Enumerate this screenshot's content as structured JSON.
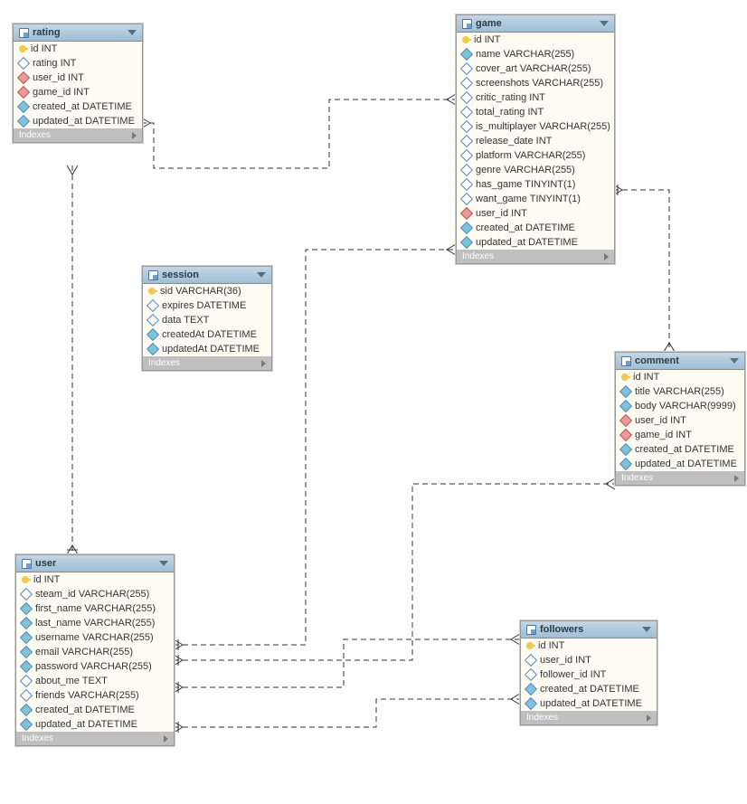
{
  "entities": {
    "rating": {
      "title": "rating",
      "indexes_label": "Indexes",
      "fields": [
        {
          "name": "id INT",
          "icon": "key"
        },
        {
          "name": "rating INT",
          "icon": "diam"
        },
        {
          "name": "user_id INT",
          "icon": "fk"
        },
        {
          "name": "game_id INT",
          "icon": "fk"
        },
        {
          "name": "created_at DATETIME",
          "icon": "solid"
        },
        {
          "name": "updated_at DATETIME",
          "icon": "solid"
        }
      ]
    },
    "game": {
      "title": "game",
      "indexes_label": "Indexes",
      "fields": [
        {
          "name": "id INT",
          "icon": "key"
        },
        {
          "name": "name VARCHAR(255)",
          "icon": "solid"
        },
        {
          "name": "cover_art VARCHAR(255)",
          "icon": "diam"
        },
        {
          "name": "screenshots VARCHAR(255)",
          "icon": "diam"
        },
        {
          "name": "critic_rating INT",
          "icon": "diam"
        },
        {
          "name": "total_rating INT",
          "icon": "diam"
        },
        {
          "name": "is_multiplayer VARCHAR(255)",
          "icon": "diam"
        },
        {
          "name": "release_date INT",
          "icon": "diam"
        },
        {
          "name": "platform VARCHAR(255)",
          "icon": "diam"
        },
        {
          "name": "genre VARCHAR(255)",
          "icon": "diam"
        },
        {
          "name": "has_game TINYINT(1)",
          "icon": "diam"
        },
        {
          "name": "want_game TINYINT(1)",
          "icon": "diam"
        },
        {
          "name": "user_id INT",
          "icon": "fk"
        },
        {
          "name": "created_at DATETIME",
          "icon": "solid"
        },
        {
          "name": "updated_at DATETIME",
          "icon": "solid"
        }
      ]
    },
    "session": {
      "title": "session",
      "indexes_label": "Indexes",
      "fields": [
        {
          "name": "sid VARCHAR(36)",
          "icon": "key"
        },
        {
          "name": "expires DATETIME",
          "icon": "diam"
        },
        {
          "name": "data TEXT",
          "icon": "diam"
        },
        {
          "name": "createdAt DATETIME",
          "icon": "solid"
        },
        {
          "name": "updatedAt DATETIME",
          "icon": "solid"
        }
      ]
    },
    "comment": {
      "title": "comment",
      "indexes_label": "Indexes",
      "fields": [
        {
          "name": "id INT",
          "icon": "key"
        },
        {
          "name": "title VARCHAR(255)",
          "icon": "solid"
        },
        {
          "name": "body VARCHAR(9999)",
          "icon": "solid"
        },
        {
          "name": "user_id INT",
          "icon": "fk"
        },
        {
          "name": "game_id INT",
          "icon": "fk"
        },
        {
          "name": "created_at DATETIME",
          "icon": "solid"
        },
        {
          "name": "updated_at DATETIME",
          "icon": "solid"
        }
      ]
    },
    "user": {
      "title": "user",
      "indexes_label": "Indexes",
      "fields": [
        {
          "name": "id INT",
          "icon": "key"
        },
        {
          "name": "steam_id VARCHAR(255)",
          "icon": "diam"
        },
        {
          "name": "first_name VARCHAR(255)",
          "icon": "solid"
        },
        {
          "name": "last_name VARCHAR(255)",
          "icon": "solid"
        },
        {
          "name": "username VARCHAR(255)",
          "icon": "solid"
        },
        {
          "name": "email VARCHAR(255)",
          "icon": "solid"
        },
        {
          "name": "password VARCHAR(255)",
          "icon": "solid"
        },
        {
          "name": "about_me TEXT",
          "icon": "diam"
        },
        {
          "name": "friends VARCHAR(255)",
          "icon": "diam"
        },
        {
          "name": "created_at DATETIME",
          "icon": "solid"
        },
        {
          "name": "updated_at DATETIME",
          "icon": "solid"
        }
      ]
    },
    "followers": {
      "title": "followers",
      "indexes_label": "Indexes",
      "fields": [
        {
          "name": "id INT",
          "icon": "key"
        },
        {
          "name": "user_id INT",
          "icon": "diam"
        },
        {
          "name": "follower_id INT",
          "icon": "diam"
        },
        {
          "name": "created_at DATETIME",
          "icon": "solid"
        },
        {
          "name": "updated_at DATETIME",
          "icon": "solid"
        }
      ]
    }
  },
  "relations": [
    {
      "from": "rating",
      "to": "game"
    },
    {
      "from": "rating",
      "to": "user"
    },
    {
      "from": "game",
      "to": "user"
    },
    {
      "from": "game",
      "to": "comment"
    },
    {
      "from": "comment",
      "to": "user"
    },
    {
      "from": "followers",
      "to": "user",
      "note": "two links"
    }
  ]
}
